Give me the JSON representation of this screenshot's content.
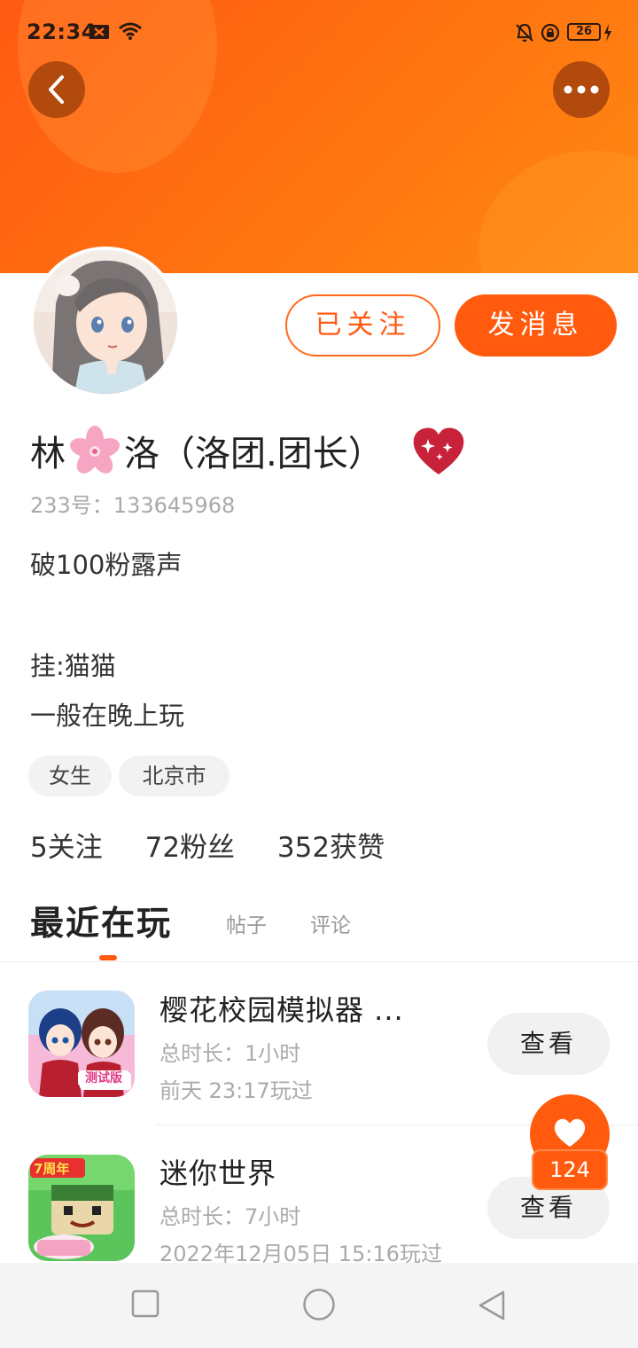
{
  "status_bar": {
    "time": "22:34",
    "battery": "26",
    "icons": [
      "x-notification-icon",
      "wifi-icon",
      "mute-bell-icon",
      "rotation-lock-icon",
      "battery-icon",
      "charging-icon"
    ]
  },
  "profile": {
    "name_prefix": "林",
    "name_suffix": "洛（洛团.团长）",
    "uid": "233号：133645968",
    "bio": [
      "破100粉露声",
      "挂:猫猫",
      "一般在晚上玩"
    ],
    "tags": [
      "女生",
      "北京市"
    ],
    "follow_button": "已关注",
    "message_button": "发消息"
  },
  "stats": {
    "following": "5关注",
    "fans": "72粉丝",
    "likes": "352获赞"
  },
  "tabs": {
    "active": "最近在玩",
    "posts": "帖子",
    "comments": "评论"
  },
  "games": [
    {
      "title": "樱花校园模拟器 ...",
      "duration": "总时长：1小时",
      "last_played": "前天 23:17玩过",
      "badge": "测试版",
      "button": "查看"
    },
    {
      "title": "迷你世界",
      "duration": "总时长：7小时",
      "last_played": "2022年12月05日 15:16玩过",
      "badge": "7周年",
      "button": "查看"
    }
  ],
  "like_fab": {
    "count": "124"
  },
  "colors": {
    "accent": "#ff5a12",
    "header_gradient_start": "#ff5a12",
    "header_gradient_end": "#ff8a14"
  }
}
